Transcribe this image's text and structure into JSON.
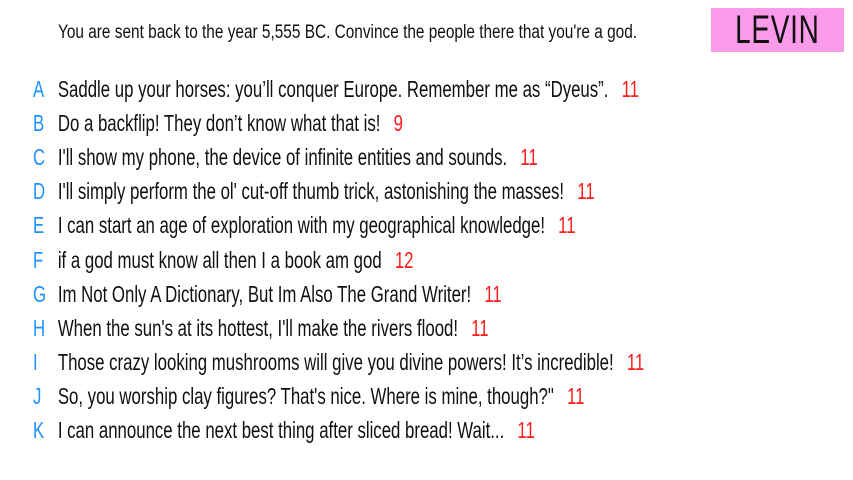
{
  "prompt": "You are sent back to the year 5,555 BC. Convince the people there that you're a god.",
  "player": {
    "name": "LEVIN",
    "color": "#f99be8"
  },
  "colors": {
    "letter": "#1e90ff",
    "score": "#ff1a1a"
  },
  "answers": [
    {
      "letter": "A",
      "text": "Saddle up your horses: you’ll conquer Europe. Remember me as “Dyeus”.",
      "score": "11"
    },
    {
      "letter": "B",
      "text": "Do a backflip! They don’t know what that is!",
      "score": "9"
    },
    {
      "letter": "C",
      "text": "I'll show my phone, the device of infinite entities and sounds.",
      "score": "11"
    },
    {
      "letter": "D",
      "text": "I'll simply perform the ol' cut-off thumb trick, astonishing the masses!",
      "score": "11"
    },
    {
      "letter": "E",
      "text": "I can start an age of exploration with my geographical knowledge!",
      "score": "11"
    },
    {
      "letter": "F",
      "text": "if a god must know all then I a book am god",
      "score": "12"
    },
    {
      "letter": "G",
      "text": "Im Not Only A Dictionary, But Im Also The Grand Writer!",
      "score": "11"
    },
    {
      "letter": "H",
      "text": "When the sun's at its hottest, I'll make the rivers flood!",
      "score": "11"
    },
    {
      "letter": "I",
      "text": "Those crazy looking mushrooms will give you divine powers! It’s incredible!",
      "score": "11"
    },
    {
      "letter": "J",
      "text": "So, you worship clay figures? That's nice. Where is mine, though?\"",
      "score": "11"
    },
    {
      "letter": "K",
      "text": "I can announce the next best thing after sliced bread! Wait...",
      "score": "11"
    }
  ]
}
